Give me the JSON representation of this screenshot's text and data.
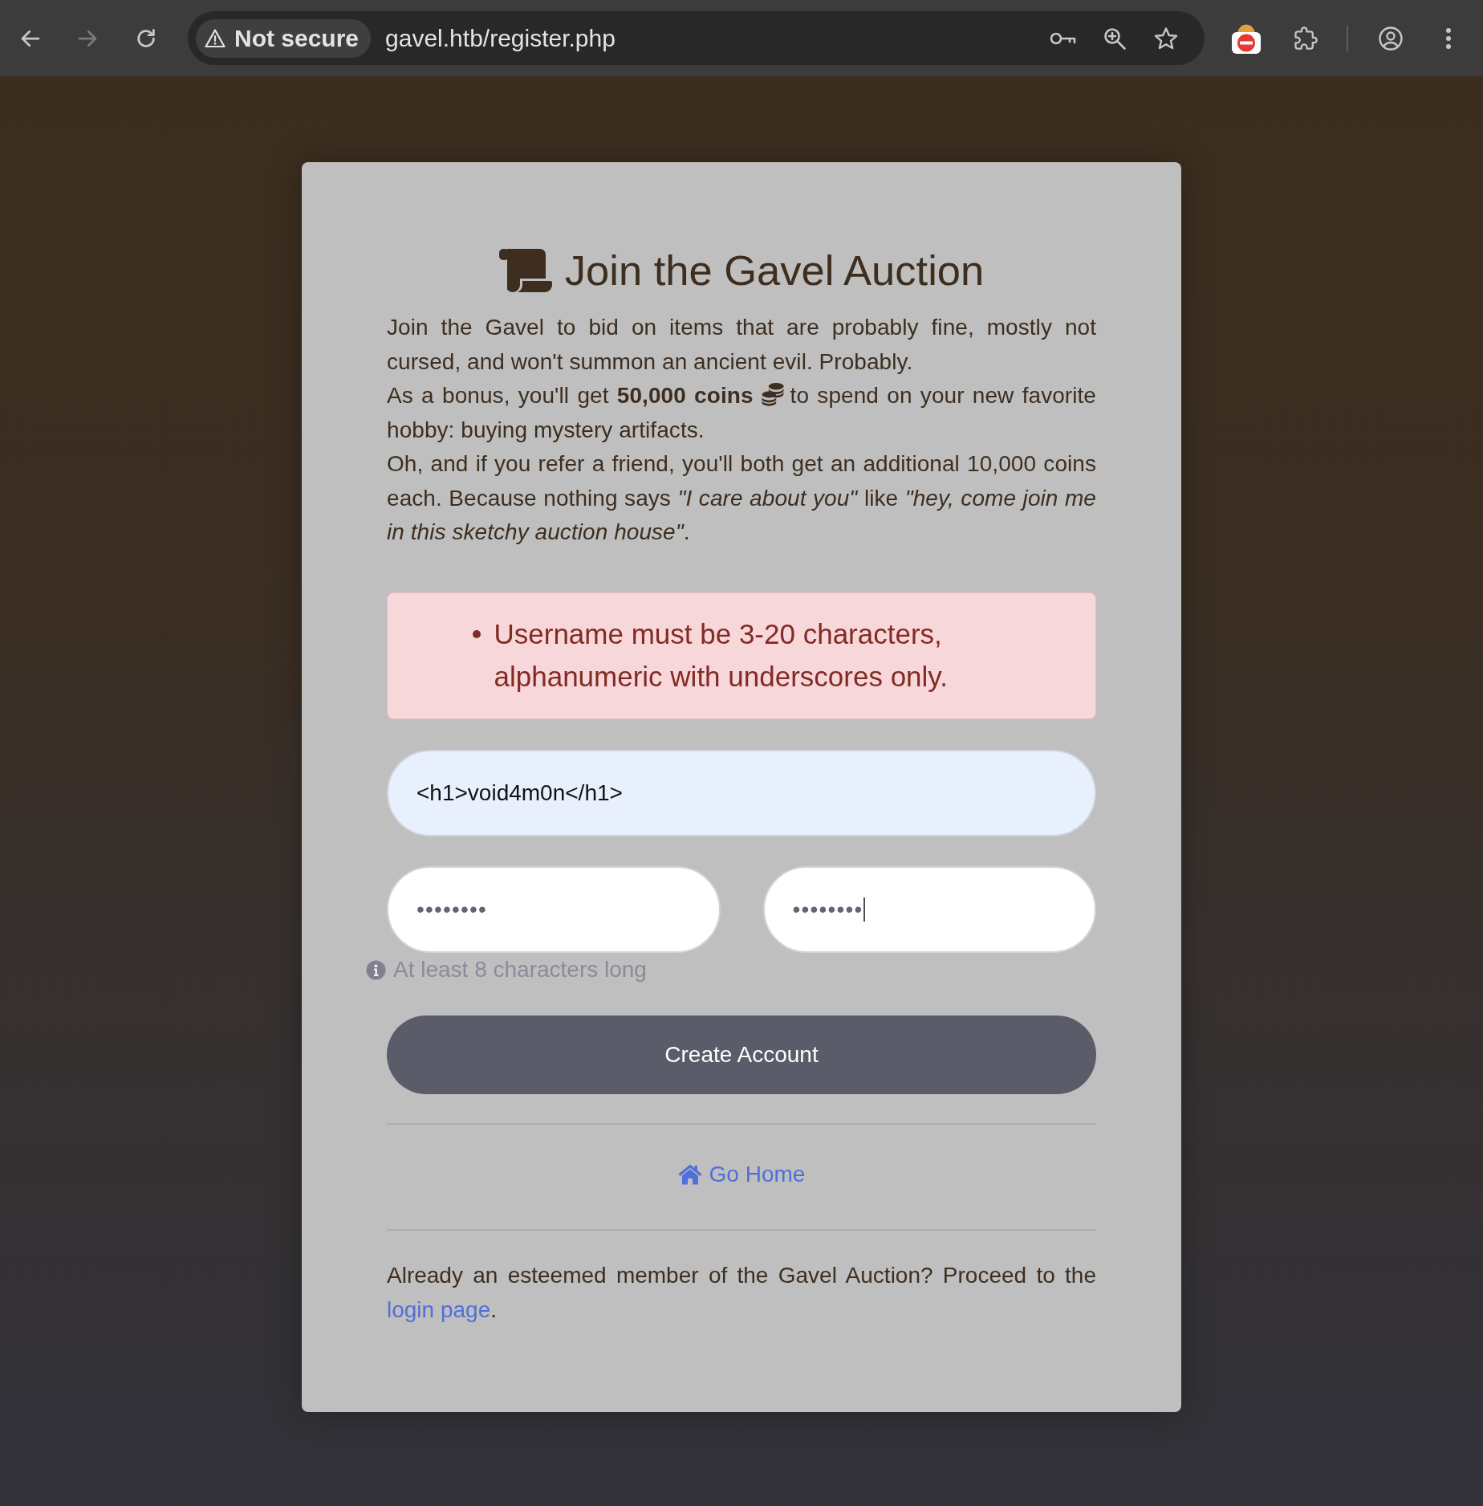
{
  "browser": {
    "back": {
      "disabled": false
    },
    "forward": {
      "disabled": true
    },
    "security_chip": "Not secure",
    "url": "gavel.htb/register.php"
  },
  "card": {
    "title": "Join the Gavel Auction",
    "intro": [
      {
        "text": "Join the Gavel to bid on items that are probably fine, mostly not cursed, and won't summon an ancient evil. Probably."
      },
      {
        "text": "As a bonus, you'll get **50,000 coins**",
        "text_after_icon": "to spend on your new favorite hobby: buying mystery artifacts."
      },
      {
        "text": "Oh, and if you refer a friend, you'll both get an additional 10,000 coins each. Because nothing says *\"I care about you\"* like *\"hey, come join me in this sketchy auction house\"*."
      }
    ],
    "errors": [
      "Username must be 3-20 characters, alphanumeric with underscores only."
    ],
    "username_field": {
      "value": "<h1>void4m0n</h1>",
      "autofilled": true,
      "focused": false
    },
    "password_fields": [
      {
        "value": "••••••••",
        "autofilled": false,
        "focused": false
      },
      {
        "value": "••••••••",
        "autofilled": false,
        "focused": true
      }
    ],
    "hint": "At least 8 characters long",
    "submit_button": "Create Account",
    "home_link": "Go Home",
    "footer": {
      "text": "Already an esteemed member of the Gavel Auction? Proceed to the",
      "link": "login page",
      "after_link": "."
    }
  }
}
